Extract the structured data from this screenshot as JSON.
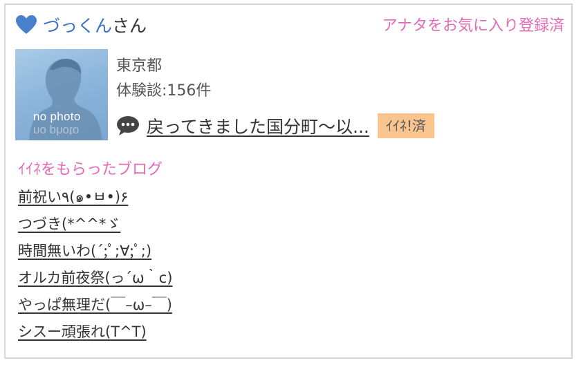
{
  "profile": {
    "name": "づっくん",
    "honorific": "さん",
    "favorite_status": "アナタをお気に入り登録済",
    "avatar_text": "no photo",
    "location": "東京都",
    "experience_label": "体験談:",
    "experience_count": "156件"
  },
  "latest_post": {
    "icon": "speech-bubble-icon",
    "title": "戻ってきました国分町〜以...",
    "like_badge": "ｲｲﾈ!済"
  },
  "liked_blogs": {
    "title": "ｲｲﾈをもらったブログ",
    "items": [
      "前祝い٩(๑•ㅂ•)۶",
      "つづき(*^^*ゞ",
      "時間無いわ(´;ﾟ;∀;ﾟ;)",
      "オルカ前夜祭(っ´ω｀c)",
      "やっぱ無理だ(￣–ω–￣)",
      "シスー頑張れ(T^T)"
    ]
  },
  "colors": {
    "accent_pink": "#e469b8",
    "name_blue": "#3a72c4",
    "badge_orange": "#f9c48e",
    "heart_blue": "#4a7fcb"
  }
}
